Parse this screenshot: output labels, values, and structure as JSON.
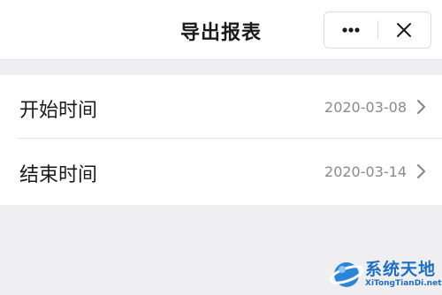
{
  "header": {
    "title": "导出报表",
    "more_icon": "more-dots-icon",
    "close_icon": "close-icon"
  },
  "list": {
    "items": [
      {
        "label": "开始时间",
        "value": "2020-03-08",
        "icon": "chevron-right-icon"
      },
      {
        "label": "结束时间",
        "value": "2020-03-14",
        "icon": "chevron-right-icon"
      }
    ]
  },
  "watermark": {
    "text": "系统天地",
    "sub": "XiTongTianDi.net",
    "color": "#1e6fc5"
  },
  "colors": {
    "background": "#efeff1",
    "surface": "#ffffff",
    "text_primary": "#1a1a1a",
    "text_secondary": "#8a8a8a"
  }
}
